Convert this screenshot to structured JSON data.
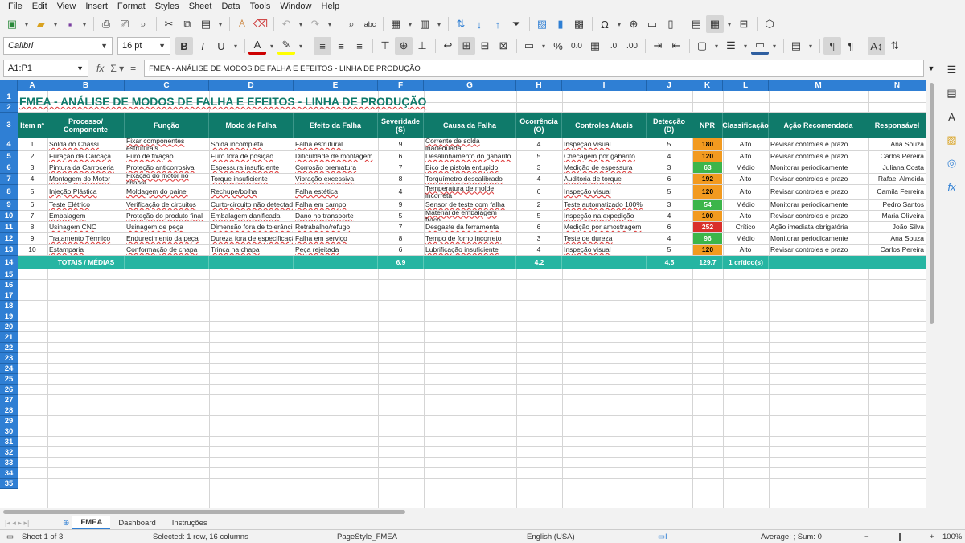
{
  "menu": [
    "File",
    "Edit",
    "View",
    "Insert",
    "Format",
    "Styles",
    "Sheet",
    "Data",
    "Tools",
    "Window",
    "Help"
  ],
  "format_toolbar": {
    "font_name": "Calibri",
    "font_size": "16 pt"
  },
  "formula_bar": {
    "name_box": "A1:P1",
    "content": "FMEA - ANÁLISE DE MODOS DE FALHA E EFEITOS - LINHA DE PRODUÇÃO"
  },
  "columns": [
    "A",
    "B",
    "C",
    "D",
    "E",
    "F",
    "G",
    "H",
    "I",
    "J",
    "K",
    "L",
    "M",
    "N"
  ],
  "row_numbers": [
    "1",
    "2",
    "3",
    "4",
    "5",
    "6",
    "7",
    "8",
    "9",
    "10",
    "11",
    "12",
    "13",
    "14",
    "15",
    "16",
    "17",
    "18",
    "19",
    "20",
    "21",
    "22",
    "23",
    "24",
    "25",
    "26",
    "27",
    "28",
    "29",
    "30",
    "31",
    "32",
    "33",
    "34",
    "35"
  ],
  "sheet": {
    "title": "FMEA - ANÁLISE DE MODOS DE FALHA E EFEITOS - LINHA DE PRODUÇÃO",
    "headers": [
      "Item nº",
      "Processo/ Componente",
      "Função",
      "Modo de Falha",
      "Efeito da Falha",
      "Severidade (S)",
      "Causa da Falha",
      "Ocorrência (O)",
      "Controles Atuais",
      "Detecção (D)",
      "NPR",
      "Classificação",
      "Ação Recomendada",
      "Responsável"
    ],
    "rows": [
      [
        "1",
        "Solda do Chassi",
        "Fixar componentes estruturais",
        "Solda incompleta",
        "Falha estrutural",
        "9",
        "Corrente de solda inadequada",
        "4",
        "Inspeção visual",
        "5",
        "180",
        "Alto",
        "Revisar controles e prazo",
        "Ana Souza"
      ],
      [
        "2",
        "Furação da Carcaça",
        "Furo de fixação",
        "Furo fora de posição",
        "Dificuldade de montagem",
        "6",
        "Desalinhamento do gabarito",
        "5",
        "Checagem por gabarito",
        "4",
        "120",
        "Alto",
        "Revisar controles e prazo",
        "Carlos Pereira"
      ],
      [
        "3",
        "Pintura da Carroceria",
        "Proteção anticorrosiva",
        "Espessura insuficiente",
        "Corrosão prematura",
        "7",
        "Bico de pistola entupido",
        "3",
        "Medição de espessura",
        "3",
        "63",
        "Médio",
        "Monitorar periodicamente",
        "Juliana Costa"
      ],
      [
        "4",
        "Montagem do Motor",
        "Fixação do motor no chassi",
        "Torque insuficiente",
        "Vibração excessiva",
        "8",
        "Torquímetro descalibrado",
        "4",
        "Auditoria de torque",
        "6",
        "192",
        "Alto",
        "Revisar controles e prazo",
        "Rafael Almeida"
      ],
      [
        "5",
        "Injeção Plástica",
        "Moldagem do painel",
        "Rechupe/bolha",
        "Falha estética",
        "4",
        "Temperatura de molde incorreta",
        "6",
        "Inspeção visual",
        "5",
        "120",
        "Alto",
        "Revisar controles e prazo",
        "Camila Ferreira"
      ],
      [
        "6",
        "Teste Elétrico",
        "Verificação de circuitos",
        "Curto-circuito não detectado",
        "Falha em campo",
        "9",
        "Sensor de teste com falha",
        "2",
        "Teste automatizado 100%",
        "3",
        "54",
        "Médio",
        "Monitorar periodicamente",
        "Pedro Santos"
      ],
      [
        "7",
        "Embalagem",
        "Proteção do produto final",
        "Embalagem danificada",
        "Dano no transporte",
        "5",
        "Material de embalagem fraco",
        "5",
        "Inspeção na expedição",
        "4",
        "100",
        "Alto",
        "Revisar controles e prazo",
        "Maria Oliveira"
      ],
      [
        "8",
        "Usinagem CNC",
        "Usinagem de peça",
        "Dimensão fora de tolerância",
        "Retrabalho/refugo",
        "7",
        "Desgaste da ferramenta",
        "6",
        "Medição por amostragem",
        "6",
        "252",
        "Crítico",
        "Ação imediata obrigatória",
        "João Silva"
      ],
      [
        "9",
        "Tratamento Térmico",
        "Endurecimento da peça",
        "Dureza fora de especificação",
        "Falha em serviço",
        "8",
        "Tempo de forno incorreto",
        "3",
        "Teste de dureza",
        "4",
        "96",
        "Médio",
        "Monitorar periodicamente",
        "Ana Souza"
      ],
      [
        "10",
        "Estamparia",
        "Conformação de chapa",
        "Trinca na chapa",
        "Peça rejeitada",
        "6",
        "Lubrificação insuficiente",
        "4",
        "Inspeção visual",
        "5",
        "120",
        "Alto",
        "Revisar controles e prazo",
        "Carlos Pereira"
      ]
    ],
    "totals": {
      "label": "TOTAIS / MÉDIAS",
      "severity": "6.9",
      "occurrence": "4.2",
      "detection": "4.5",
      "npr": "129.7",
      "classification": "1 crítico(s)"
    }
  },
  "npr_colors": {
    "critical": "#d9302c",
    "high": "#f29a1f",
    "medium": "#3cb54a"
  },
  "header_color": "#0f7a6a",
  "totals_color": "#26b5a2",
  "tabs": [
    "FMEA",
    "Dashboard",
    "Instruções"
  ],
  "active_tab": "FMEA",
  "status": {
    "sheet": "Sheet 1 of 3",
    "selection": "Selected: 1 row, 16 columns",
    "page_style": "PageStyle_FMEA",
    "language": "English (USA)",
    "summary": "Average: ; Sum: 0",
    "zoom": "100%"
  }
}
